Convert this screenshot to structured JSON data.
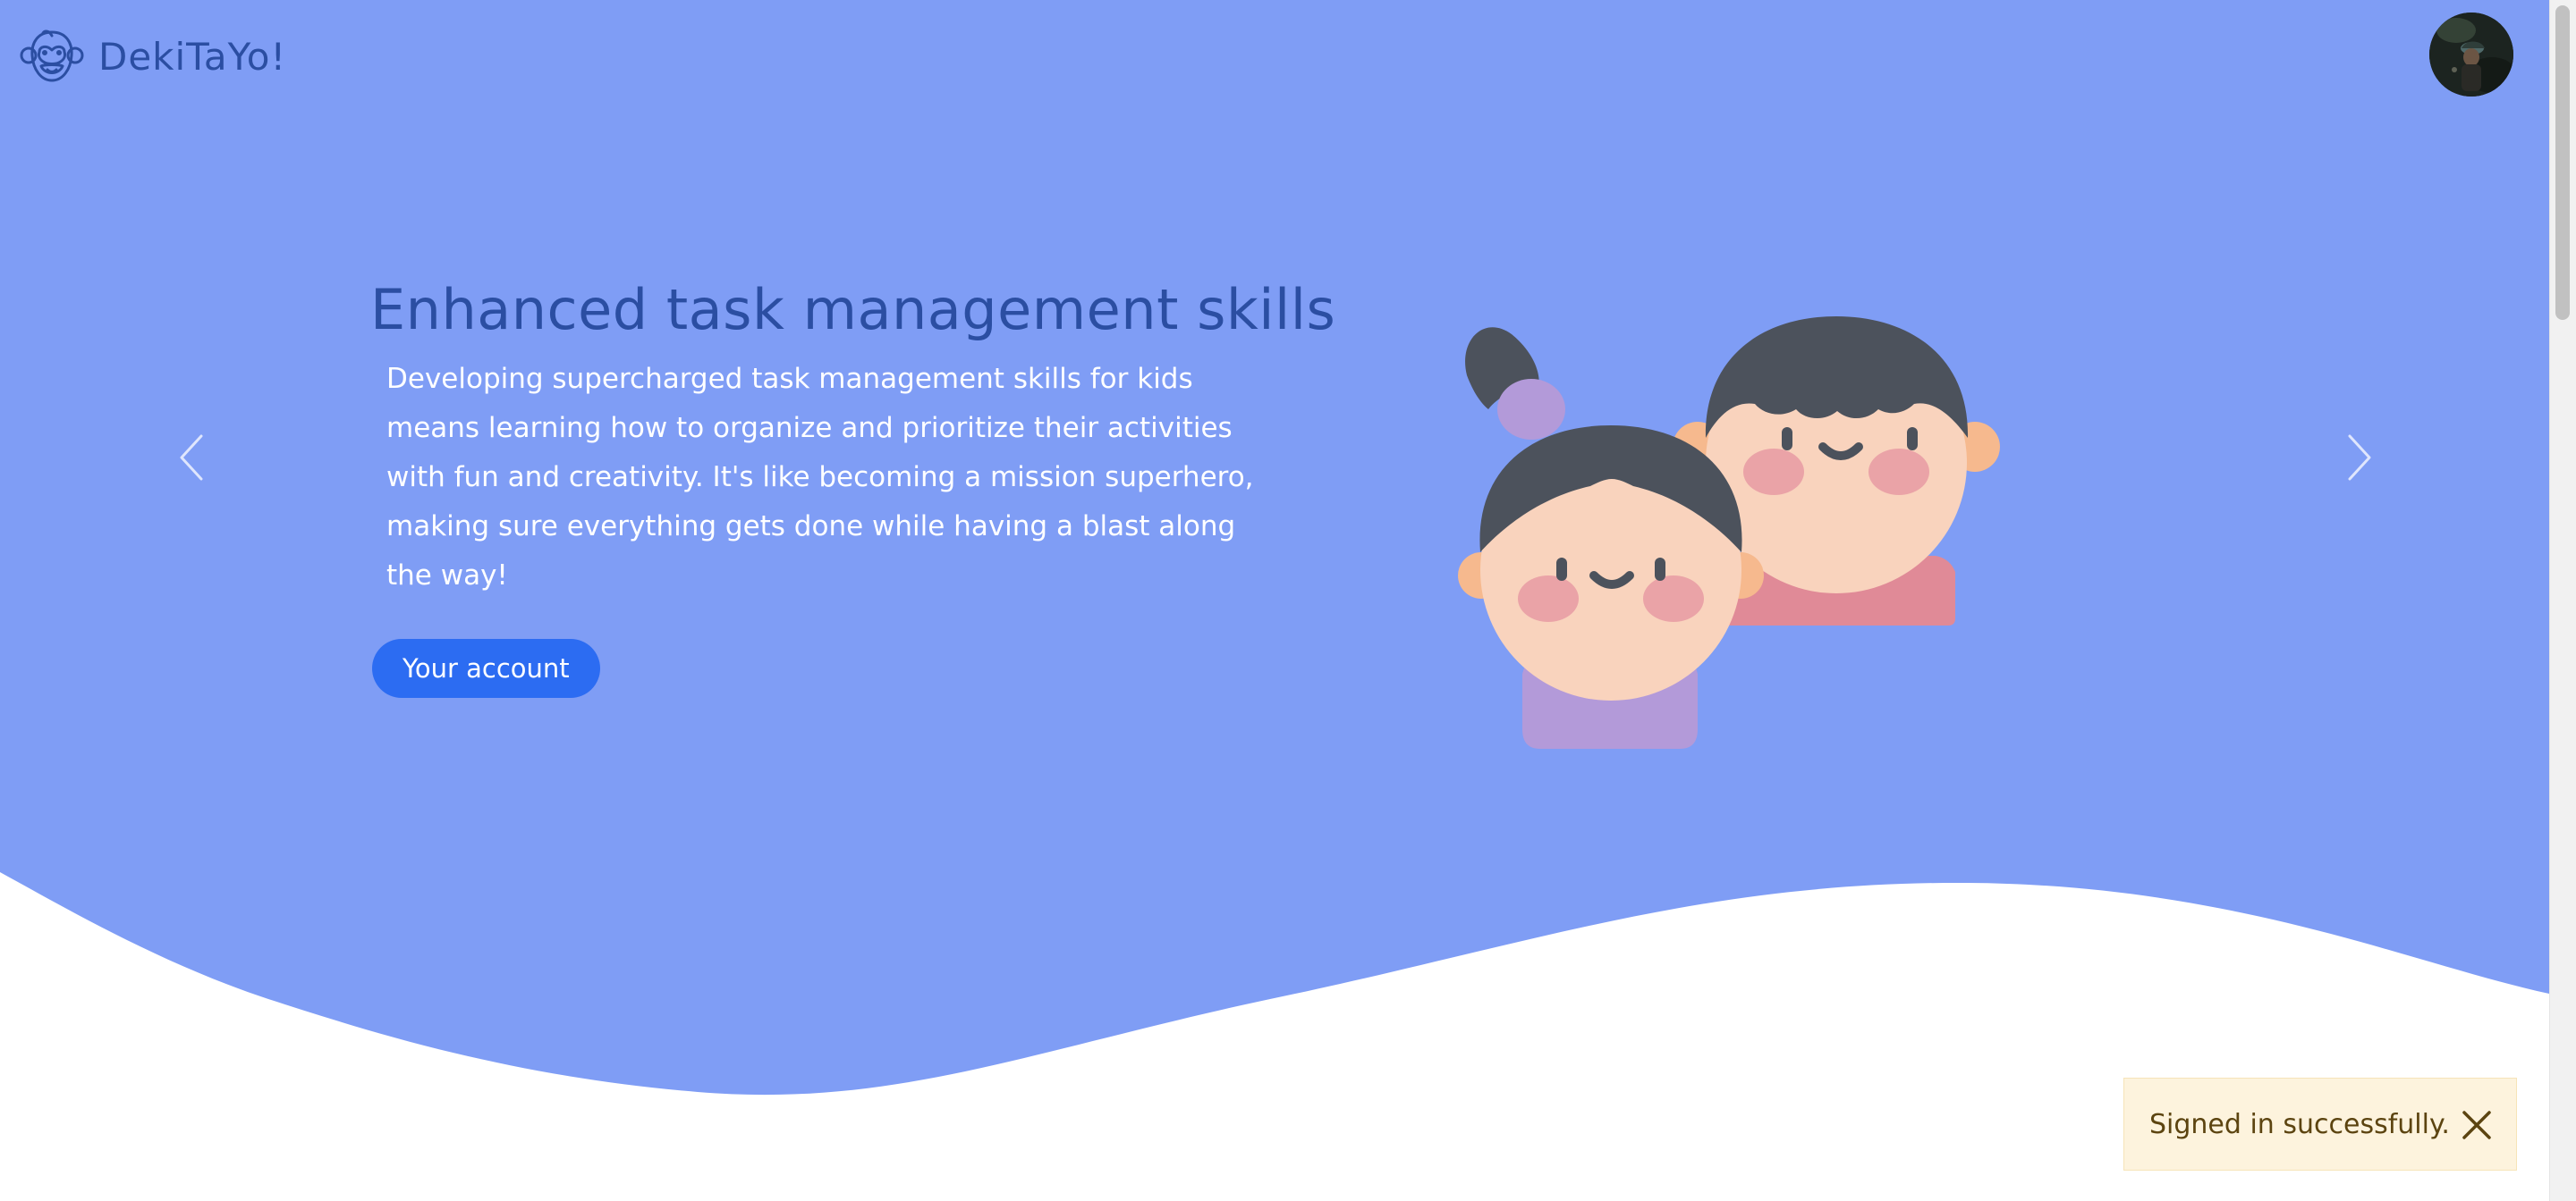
{
  "brand": {
    "name": "DekiTaYo!",
    "logo_icon": "monkey-face-icon",
    "color": "#2b4ea2"
  },
  "user": {
    "avatar_icon": "user-avatar-photo"
  },
  "hero": {
    "background_color": "#7f9df5",
    "slide": {
      "title": "Enhanced task management skills",
      "description": "Developing supercharged task management skills for kids means learning how to organize and prioritize their activities with fun and creativity. It's like becoming a mission superhero, making sure everything gets done while having a blast along the way!",
      "button_label": "Your account",
      "illustration_icon": "two-kids-illustration"
    },
    "prev_icon": "chevron-left-icon",
    "next_icon": "chevron-right-icon"
  },
  "toast": {
    "message": "Signed in successfully.",
    "close_icon": "close-icon",
    "background_color": "#fdf3dd"
  },
  "colors": {
    "accent_button": "#2c6cf2",
    "title_text": "#2b4ea2"
  }
}
